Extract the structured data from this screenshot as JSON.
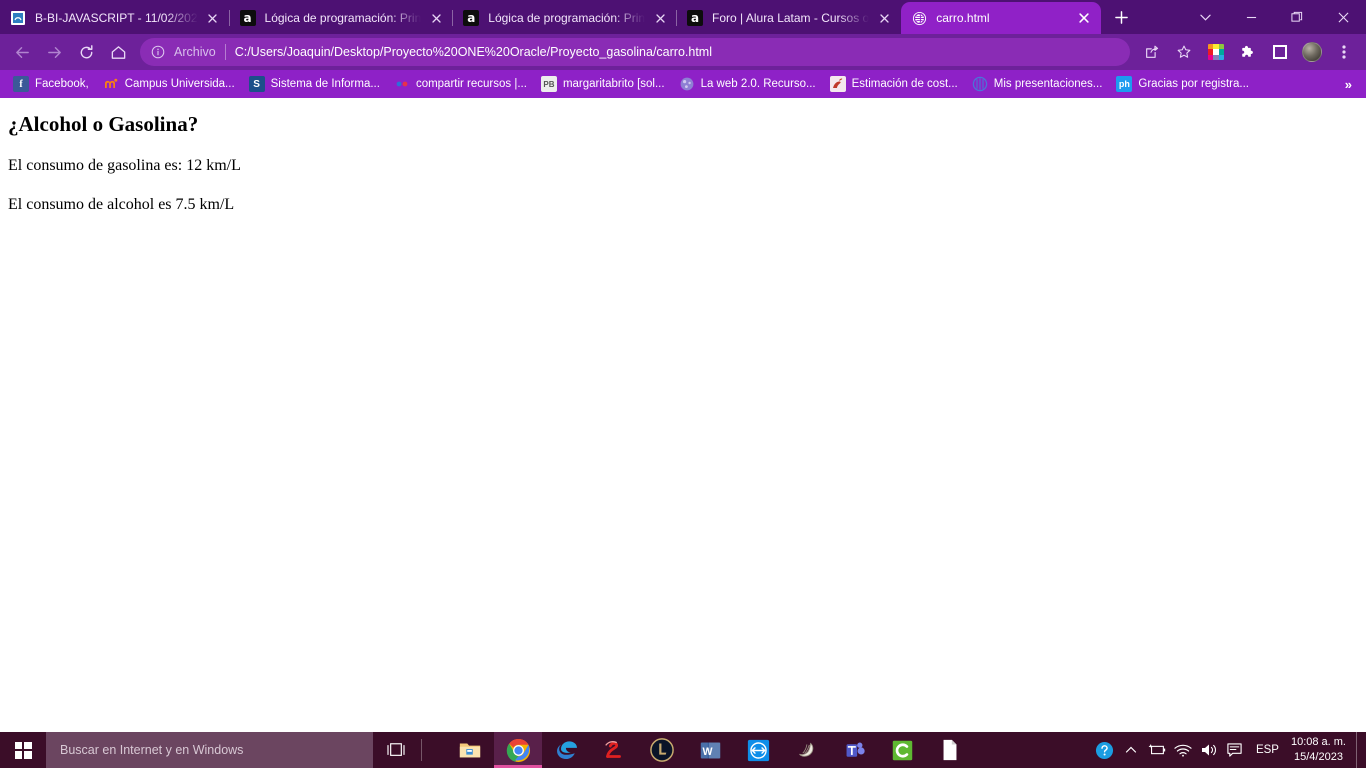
{
  "browser": {
    "tabs": [
      {
        "title": "B-BI-JAVASCRIPT - 11/02/202",
        "favicon": "document-blue-icon",
        "active": false
      },
      {
        "title": "Lógica de programación: Prin",
        "favicon": "alura-icon",
        "active": false
      },
      {
        "title": "Lógica de programación: Prin",
        "favicon": "alura-icon",
        "active": false
      },
      {
        "title": "Foro | Alura Latam - Cursos o",
        "favicon": "alura-icon",
        "active": false
      },
      {
        "title": "carro.html",
        "favicon": "globe-icon",
        "active": true
      }
    ],
    "new_tab_label": "+",
    "window_controls": {
      "tab_search": "tab-search-icon",
      "minimize": "minimize-icon",
      "maximize": "maximize-icon",
      "close": "close-icon"
    },
    "toolbar": {
      "back": "back-arrow-icon",
      "forward": "forward-arrow-icon",
      "reload": "reload-icon",
      "home": "home-icon",
      "omnibox": {
        "info_icon": "info-circle-icon",
        "scheme_label": "Archivo",
        "url": "C:/Users/Joaquin/Desktop/Proyecto%20ONE%20Oracle/Proyecto_gasolina/carro.html"
      },
      "share": "share-icon",
      "bookmark_star": "star-icon",
      "extension_grid": "color-grid-extension-icon",
      "extensions": "puzzle-piece-icon",
      "side_panel": "side-panel-icon",
      "profile": "avatar-icon",
      "menu": "three-dot-menu-icon"
    },
    "bookmarks": {
      "items": [
        {
          "label": "Facebook,",
          "icon": "facebook-icon",
          "icon_text": "f",
          "icon_bg": "#3b5998"
        },
        {
          "label": "Campus Universida...",
          "icon": "moodle-icon",
          "icon_text": "m",
          "icon_bg": "#f98012"
        },
        {
          "label": "Sistema de Informa...",
          "icon": "s-icon",
          "icon_text": "S",
          "icon_bg": "#1c4f8a"
        },
        {
          "label": "compartir recursos |...",
          "icon": "dots-icon",
          "icon_text": "",
          "icon_bg": "transparent"
        },
        {
          "label": "margaritabrito [sol...",
          "icon": "pb-icon",
          "icon_text": "PB",
          "icon_bg": "#e9e9e9"
        },
        {
          "label": "La web 2.0. Recurso...",
          "icon": "purple-circle-icon",
          "icon_text": "",
          "icon_bg": "transparent"
        },
        {
          "label": "Estimación de cost...",
          "icon": "swan-icon",
          "icon_text": "",
          "icon_bg": "#f2e6ea"
        },
        {
          "label": "Mis presentaciones...",
          "icon": "blue-circle-icon",
          "icon_text": "",
          "icon_bg": "transparent"
        },
        {
          "label": "Gracias por registra...",
          "icon": "ph-icon",
          "icon_text": "ph",
          "icon_bg": "#1d9bf0"
        }
      ],
      "overflow_label": "»"
    },
    "page": {
      "heading": "¿Alcohol o Gasolina?",
      "line1": "El consumo de gasolina es: 12 km/L",
      "line2": "El consumo de alcohol es 7.5 km/L"
    }
  },
  "taskbar": {
    "start_button": "windows-start-icon",
    "search_placeholder": "Buscar en Internet y en Windows",
    "task_view": "task-view-icon",
    "apps": [
      {
        "name": "file-explorer",
        "active": false
      },
      {
        "name": "google-chrome",
        "active": true
      },
      {
        "name": "microsoft-edge",
        "active": false
      },
      {
        "name": "red-two-app",
        "active": false
      },
      {
        "name": "league-of-legends",
        "active": false
      },
      {
        "name": "microsoft-word",
        "active": false
      },
      {
        "name": "teamviewer",
        "active": false
      },
      {
        "name": "shell-app",
        "active": false
      },
      {
        "name": "microsoft-teams",
        "active": false
      },
      {
        "name": "green-c-app",
        "active": false
      },
      {
        "name": "document-app",
        "active": false
      }
    ],
    "tray": {
      "help": "help-circle-icon",
      "show_hidden": "chevron-up-icon",
      "battery": "battery-icon",
      "network": "wifi-icon",
      "volume": "volume-icon",
      "action_center": "notifications-icon",
      "language": "ESP",
      "time": "10:08 a. m.",
      "date": "15/4/2023"
    }
  }
}
